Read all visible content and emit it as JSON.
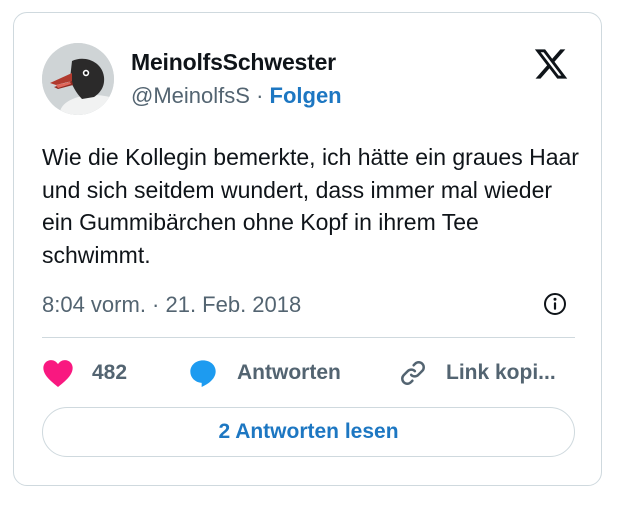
{
  "author": {
    "display_name": "MeinolfsSchwester",
    "handle": "@MeinolfsS",
    "separator": "·",
    "follow_label": "Folgen",
    "avatar_icon": "black-headed-gull-avatar"
  },
  "brand": {
    "logo_icon": "x-logo-icon"
  },
  "tweet": {
    "text": "Wie die Kollegin bemerkte, ich hätte ein graues Haar und sich seitdem wundert, dass immer mal wieder ein Gummibärchen ohne Kopf in ihrem Tee schwimmt.",
    "timestamp": "8:04 vorm. · 21. Feb. 2018"
  },
  "actions": {
    "like_count": "482",
    "reply_label": "Antworten",
    "copy_link_label": "Link kopi..."
  },
  "footer": {
    "read_replies_label": "2 Antworten lesen"
  },
  "colors": {
    "like": "#f91880",
    "reply": "#1d9bf0",
    "link_blue": "#1d77c2",
    "muted": "#536471",
    "border": "#cfd9de"
  }
}
